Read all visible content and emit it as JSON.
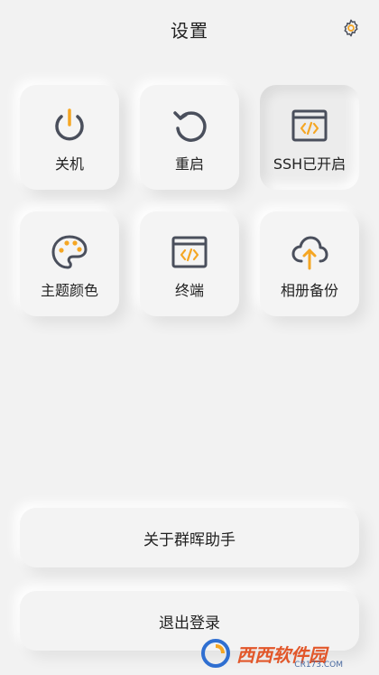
{
  "header": {
    "title": "设置"
  },
  "tiles": [
    {
      "label": "关机",
      "icon": "power-icon"
    },
    {
      "label": "重启",
      "icon": "restart-icon"
    },
    {
      "label": "SSH已开启",
      "icon": "code-window-icon"
    },
    {
      "label": "主题颜色",
      "icon": "palette-icon"
    },
    {
      "label": "终端",
      "icon": "terminal-icon"
    },
    {
      "label": "相册备份",
      "icon": "cloud-upload-icon"
    }
  ],
  "buttons": {
    "about": "关于群晖助手",
    "logout": "退出登录"
  },
  "watermark": {
    "text": "西西软件园",
    "sub": "CR173.COM"
  },
  "colors": {
    "accent": "#f5a623",
    "icon_dark": "#4a4f5c",
    "background": "#f2f2f2"
  }
}
